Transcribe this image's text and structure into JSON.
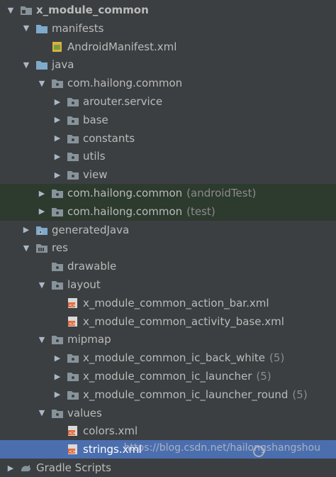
{
  "tree": [
    {
      "label": "x_module_common",
      "icon": "module-icon",
      "expanded": true,
      "bold": true,
      "depth": 0,
      "name": "x-module-common"
    },
    {
      "label": "manifests",
      "icon": "folder-icon",
      "expanded": true,
      "depth": 1,
      "name": "manifests"
    },
    {
      "label": "AndroidManifest.xml",
      "icon": "manifest-file-icon",
      "depth": 2,
      "leaf": true,
      "name": "android-manifest"
    },
    {
      "label": "java",
      "icon": "folder-icon",
      "expanded": true,
      "depth": 1,
      "name": "java"
    },
    {
      "label": "com.hailong.common",
      "icon": "package-icon",
      "expanded": true,
      "depth": 2,
      "name": "com-hailong-common"
    },
    {
      "label": "arouter.service",
      "icon": "package-icon",
      "expanded": false,
      "depth": 3,
      "name": "arouter-service"
    },
    {
      "label": "base",
      "icon": "package-icon",
      "expanded": false,
      "depth": 3,
      "name": "base"
    },
    {
      "label": "constants",
      "icon": "package-icon",
      "expanded": false,
      "depth": 3,
      "name": "constants"
    },
    {
      "label": "utils",
      "icon": "package-icon",
      "expanded": false,
      "depth": 3,
      "name": "utils"
    },
    {
      "label": "view",
      "icon": "package-icon",
      "expanded": false,
      "depth": 3,
      "name": "view"
    },
    {
      "label": "com.hailong.common",
      "extra": "(androidTest)",
      "icon": "package-icon",
      "expanded": false,
      "depth": 2,
      "green": true,
      "name": "com-hailong-common-androidtest"
    },
    {
      "label": "com.hailong.common",
      "extra": "(test)",
      "icon": "package-icon",
      "expanded": false,
      "depth": 2,
      "green": true,
      "name": "com-hailong-common-test"
    },
    {
      "label": "generatedJava",
      "icon": "generated-folder-icon",
      "expanded": false,
      "depth": 1,
      "name": "generated-java"
    },
    {
      "label": "res",
      "icon": "res-folder-icon",
      "expanded": true,
      "depth": 1,
      "name": "res"
    },
    {
      "label": "drawable",
      "icon": "package-icon",
      "depth": 2,
      "leaf": true,
      "name": "drawable"
    },
    {
      "label": "layout",
      "icon": "package-icon",
      "expanded": true,
      "depth": 2,
      "name": "layout"
    },
    {
      "label": "x_module_common_action_bar.xml",
      "icon": "layout-file-icon",
      "depth": 3,
      "leaf": true,
      "name": "action-bar-xml"
    },
    {
      "label": "x_module_common_activity_base.xml",
      "icon": "layout-file-icon",
      "depth": 3,
      "leaf": true,
      "name": "activity-base-xml"
    },
    {
      "label": "mipmap",
      "icon": "package-icon",
      "expanded": true,
      "depth": 2,
      "name": "mipmap"
    },
    {
      "label": "x_module_common_ic_back_white",
      "extra": "(5)",
      "icon": "package-icon",
      "expanded": false,
      "depth": 3,
      "name": "ic-back-white"
    },
    {
      "label": "x_module_common_ic_launcher",
      "extra": "(5)",
      "icon": "package-icon",
      "expanded": false,
      "depth": 3,
      "name": "ic-launcher"
    },
    {
      "label": "x_module_common_ic_launcher_round",
      "extra": "(5)",
      "icon": "package-icon",
      "expanded": false,
      "depth": 3,
      "name": "ic-launcher-round"
    },
    {
      "label": "values",
      "icon": "package-icon",
      "expanded": true,
      "depth": 2,
      "name": "values"
    },
    {
      "label": "colors.xml",
      "icon": "values-file-icon",
      "depth": 3,
      "leaf": true,
      "name": "colors-xml"
    },
    {
      "label": "strings.xml",
      "icon": "values-file-icon",
      "depth": 3,
      "leaf": true,
      "selected": true,
      "name": "strings-xml"
    },
    {
      "label": "Gradle Scripts",
      "icon": "gradle-icon",
      "expanded": false,
      "depth": 0,
      "name": "gradle-scripts"
    }
  ],
  "watermark": "https://blog.csdn.net/hailongshangshou",
  "colors": {
    "background": "#3c3f41",
    "selection": "#4b6eaf",
    "test_row": "#2d3a2e",
    "folder": "#7eaacb"
  }
}
